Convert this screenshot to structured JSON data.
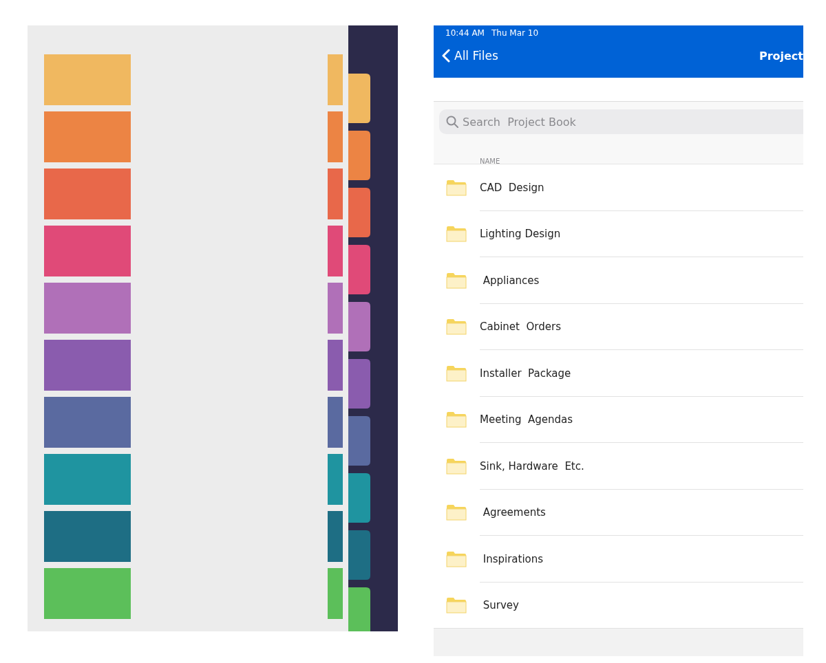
{
  "status_bar": {
    "time": "10:44 AM",
    "date": "Thu Mar 10"
  },
  "nav_bar": {
    "back_label": "All Files",
    "title": "Project"
  },
  "search": {
    "placeholder": "Search  Project Book"
  },
  "table": {
    "columns": [
      "NAME"
    ],
    "rows": [
      {
        "name": "CAD  Design"
      },
      {
        "name": "Lighting Design"
      },
      {
        "name": " Appliances"
      },
      {
        "name": "Cabinet  Orders"
      },
      {
        "name": "Installer  Package"
      },
      {
        "name": "Meeting  Agendas"
      },
      {
        "name": "Sink, Hardware  Etc."
      },
      {
        "name": " Agreements"
      },
      {
        "name": " Inspirations"
      },
      {
        "name": " Survey"
      }
    ]
  }
}
